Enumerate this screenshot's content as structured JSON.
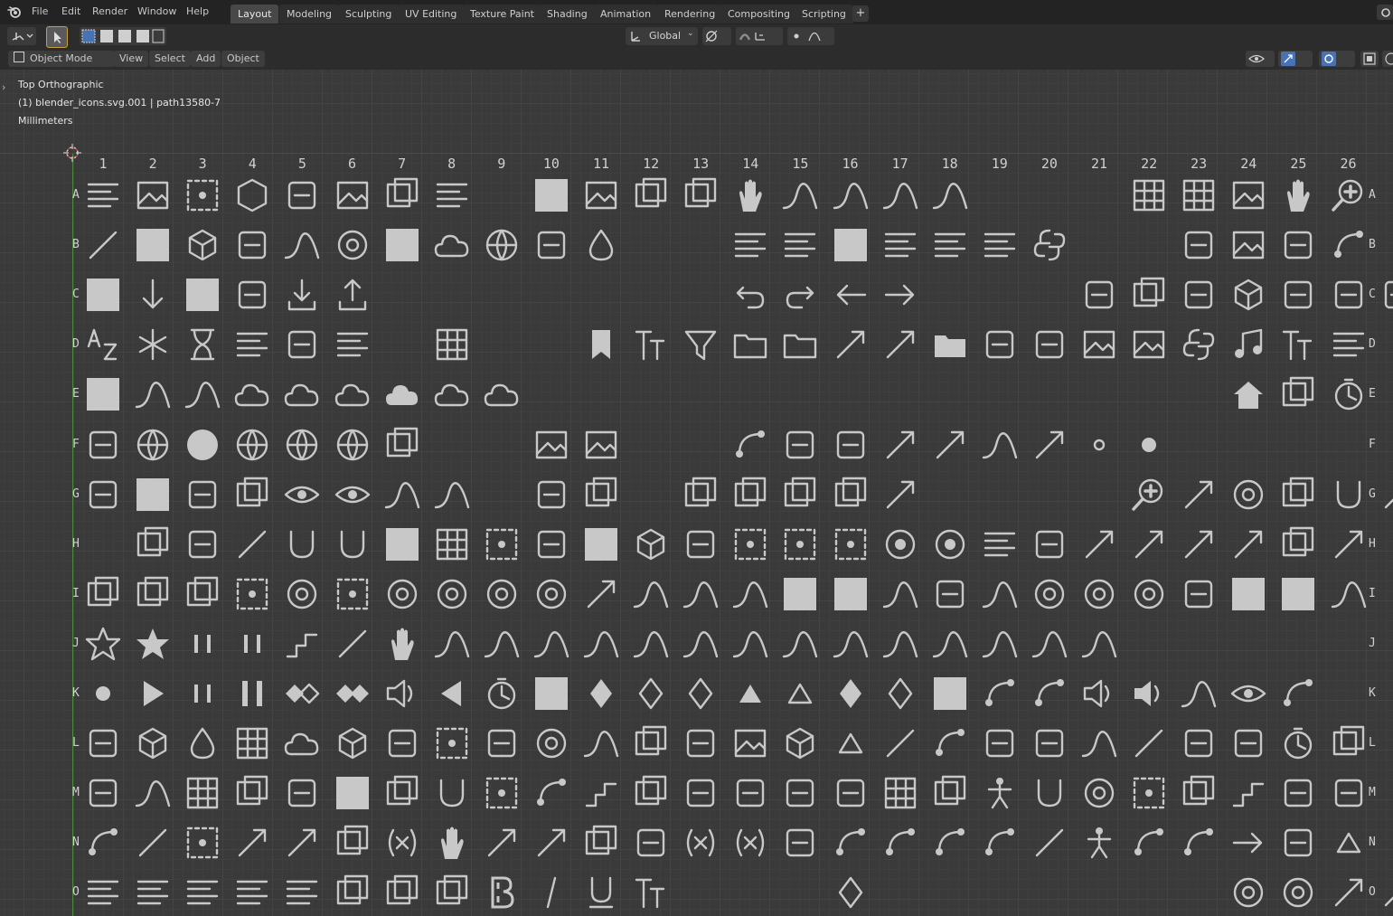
{
  "menubar": {
    "items": [
      "File",
      "Edit",
      "Render",
      "Window",
      "Help"
    ]
  },
  "workspace_tabs": [
    {
      "label": "Layout",
      "active": true
    },
    {
      "label": "Modeling"
    },
    {
      "label": "Sculpting"
    },
    {
      "label": "UV Editing"
    },
    {
      "label": "Texture Paint"
    },
    {
      "label": "Shading"
    },
    {
      "label": "Animation"
    },
    {
      "label": "Rendering"
    },
    {
      "label": "Compositing"
    },
    {
      "label": "Scripting"
    }
  ],
  "tab_add_label": "+",
  "toolbar": {
    "transform_orientation": "Global"
  },
  "header": {
    "mode": "Object Mode",
    "menus": [
      "View",
      "Select",
      "Add",
      "Object"
    ]
  },
  "viewport_overlay": {
    "view_name": "Top Orthographic",
    "object_info": "(1) blender_icons.svg.001 | path13580-7",
    "units": "Millimeters"
  },
  "grid": {
    "columns": [
      "1",
      "2",
      "3",
      "4",
      "5",
      "6",
      "7",
      "8",
      "9",
      "10",
      "11",
      "12",
      "13",
      "14",
      "15",
      "16",
      "17",
      "18",
      "19",
      "20",
      "21",
      "22",
      "23",
      "24",
      "25",
      "26"
    ],
    "rows": [
      "A",
      "B",
      "C",
      "D",
      "E",
      "F",
      "G",
      "H",
      "I",
      "J",
      "K",
      "L",
      "M",
      "N",
      "O"
    ],
    "right_rows": [
      "A",
      "B",
      "C",
      "D",
      "E",
      "F",
      "G",
      "H",
      "I",
      "J",
      "K",
      "L",
      "M",
      "N",
      "O"
    ]
  },
  "colors": {
    "background": "#393939",
    "topbar": "#232323",
    "icon": "#c8c8c8",
    "x_axis": "#8e2d2d",
    "y_axis": "#4b8a3a",
    "active_tab": "#484848"
  },
  "icon_sheet": [
    {
      "row": "A",
      "icons": [
        "align-icon",
        "image-icon",
        "dots-diagonal-icon",
        "hexagon-icon",
        "histogram-icon",
        "image-plane-icon",
        "select-box-icon",
        "align-bars-icon",
        "",
        "blank-square-icon",
        "image-alpha-icon",
        "half-square-icon",
        "overlap-squares-icon",
        "curve-handle-icon",
        "curve-arc-icon",
        "curve-point-icon",
        "curve-peak-icon",
        "curve-vertex-icon",
        "",
        "",
        "",
        "grid-perspective-icon",
        "grid-icon",
        "camera-film-icon",
        "hand-icon",
        "zoom-in-icon"
      ]
    },
    {
      "row": "B",
      "icons": [
        "square-outline-icon",
        "square-filled-icon",
        "cube-icon",
        "monkey-icon",
        "wave-icon",
        "circle-dots-icon",
        "square-filled-icon",
        "particles-icon",
        "sphere-head-icon",
        "shirt-icon",
        "drop-icon",
        "",
        "",
        "text-lines-icon",
        "text-box-icon",
        "square-filled-icon",
        "list-header-icon",
        "list-lines-icon",
        "numbered-list-icon",
        "python-icon",
        "",
        "",
        "disc-icon",
        "window-icon",
        "device-icon",
        "node-tree-icon"
      ]
    },
    {
      "row": "C",
      "icons": [
        "square-filled-icon",
        "arrow-down-icon",
        "square-filled-icon",
        "paperclip-icon",
        "import-icon",
        "export-icon",
        "",
        "",
        "",
        "",
        "",
        "",
        "",
        "undo-icon",
        "redo-icon",
        "arrow-left-icon",
        "arrow-right-icon",
        "",
        "",
        "",
        "pixel-icon",
        "settings-box-icon",
        "volume-icon",
        "cube-outline-icon",
        "file-fold-icon",
        "bake-icon",
        "sd-card-icon"
      ]
    },
    {
      "row": "D",
      "icons": [
        "sort-az-icon",
        "asterisk-icon",
        "hourglass-icon",
        "sort-lines-icon",
        "sequence-icon",
        "dotted-list-icon",
        "",
        "grid-four-icon",
        "",
        "",
        "bookmark-icon",
        "font-f-icon",
        "filter-icon",
        "new-folder-icon",
        "folder-link-icon",
        "parent-arrow-icon",
        "refresh-icon",
        "folder-icon",
        "half-flag-icon",
        "blender-icon",
        "image-file-icon",
        "film-icon",
        "python-logo-icon",
        "music-icon",
        "font-icon",
        "text-align-icon"
      ]
    },
    {
      "row": "E",
      "icons": [
        "square-filled-icon",
        "stroke-icon",
        "stroke-two-icon",
        "metaballs-icon",
        "metaball-outline-icon",
        "metaball-split-icon",
        "cloud-filled-icon",
        "cloud-outline-icon",
        "cloud-outline-icon",
        "",
        "",
        "",
        "",
        "",
        "",
        "",
        "",
        "",
        "",
        "",
        "",
        "",
        "",
        "home-icon",
        "stack-icon",
        "dashed-clock-icon"
      ]
    },
    {
      "row": "F",
      "icons": [
        "fullscreen-icon",
        "globe-icon",
        "sphere-filled-icon",
        "sphere-shaded-icon",
        "sphere-half-icon",
        "sphere-link-icon",
        "square-link-icon",
        "",
        "",
        "monitor-link-icon",
        "monitor-icon",
        "",
        "",
        "book-open-icon",
        "book-page-icon",
        "plane-icon",
        "lock-move-icon",
        "rotate-arrow-icon",
        "wave-tilde-icon",
        "vertical-arrows-icon",
        "small-dot-icon",
        "dot-icon"
      ]
    },
    {
      "row": "G",
      "icons": [
        "clipboard-paste-icon",
        "square-filled-icon",
        "cursor-select-icon",
        "scale-box-icon",
        "eye-cursor-icon",
        "eye-curve-icon",
        "cursor-curve-icon",
        "curve-bracket-icon",
        "",
        "link-dash-icon",
        "link-box-icon",
        "",
        "parent-boxes-icon",
        "box-split-icon",
        "box-cut-icon",
        "box-bar-icon",
        "resize-diag-icon",
        "",
        "",
        "",
        "",
        "zoom-box-icon",
        "arc-arrow-icon",
        "ring-cross-icon",
        "transform-box-icon",
        "hook-box-icon",
        "corner-arrow-icon"
      ]
    },
    {
      "row": "H",
      "icons": [
        "",
        "square-dot-icon",
        "axis-corner-icon",
        "line-dot-icon",
        "magnet-icon",
        "magnet-filled-icon",
        "square-filled-icon",
        "snap-grid-icon",
        "four-dots-icon",
        "bars-icon",
        "square-filled-icon",
        "cube-solid-icon",
        "ruler-icon",
        "dotted-box-icon",
        "scatter-icon",
        "diagonal-dots-icon",
        "record-icon",
        "record-ring-icon",
        "align-center-icon",
        "perspective-icon",
        "move-up-icon",
        "axis-arrows-icon",
        "cross-arrows-icon",
        "vertex-arrows-icon",
        "box-arrow-icon",
        "corner-arrows-icon"
      ]
    },
    {
      "row": "I",
      "icons": [
        "square-rounded-icon",
        "square-rotate-icon",
        "square-back-icon",
        "dashed-loop-icon",
        "x-circle-icon",
        "dashed-square-icon",
        "x-target-icon",
        "two-circles-icon",
        "link-circles-icon",
        "overlap-circles-icon",
        "double-arrow-icon",
        "hill-icon",
        "bell-curve-icon",
        "arch-icon",
        "square-filled-icon",
        "square-filled-icon",
        "peak-icon",
        "bracket-icon",
        "spike-icon",
        "target-icon",
        "ring-double-icon",
        "ring-icon",
        "spiral-icon",
        "square-filled-icon",
        "square-filled-icon",
        "arc-stroke-icon"
      ]
    },
    {
      "row": "J",
      "icons": [
        "star-outline-icon",
        "star-filled-icon",
        "tick-icon",
        "dashed-cut-icon",
        "step-icon",
        "line-icon",
        "curve-handle-icon",
        "curve-one-icon",
        "curve-two-icon",
        "curve-three-icon",
        "curve-four-icon",
        "curve-five-icon",
        "curve-s-icon",
        "curve-smooth-icon",
        "curve-noise-icon",
        "curve-wavy-icon",
        "curve-valley-icon",
        "curve-rise-icon",
        "curve-ease-icon",
        "curve-soft-icon",
        "curve-frame-icon"
      ]
    },
    {
      "row": "K",
      "icons": [
        "dot-filled-icon",
        "play-icon",
        "tick-icon",
        "pause-icon",
        "bow-tie-icon",
        "bow-tie-filled-icon",
        "speaker-wave-icon",
        "play-reverse-icon",
        "stopwatch-icon",
        "square-filled-icon",
        "keyframe-tall-icon",
        "keyframe-outline-icon",
        "keyframe-outline-icon",
        "triangle-filled-icon",
        "triangle-outline-icon",
        "diamond-filled-icon",
        "diamond-outline-icon",
        "square-filled-icon",
        "node-x-icon",
        "node-plus-icon",
        "speaker-icon",
        "speaker-loud-icon",
        "smile-curve-icon",
        "eye-icon",
        "nodes-transform-icon"
      ]
    },
    {
      "row": "L",
      "icons": [
        "armature-icon",
        "cube-split-icon",
        "drop-outline-icon",
        "grid-cells-icon",
        "blob-icon",
        "cube-open-icon",
        "donut-icon",
        "dotted-network-icon",
        "splash-icon",
        "half-circle-icon",
        "waves-icon",
        "bezier-box-icon",
        "corner-round-icon",
        "window-split-icon",
        "cube-dotted-icon",
        "target-triangle-icon",
        "spline-icon",
        "nodes-icon",
        "sliders-icon",
        "zigzag-icon",
        "curve-branch-icon",
        "node-line-icon",
        "thick-arc-icon",
        "signal-icon",
        "clock-icon",
        "copy-icon"
      ]
    },
    {
      "row": "M",
      "icons": [
        "wrench-icon",
        "wave-corner-icon",
        "bricks-icon",
        "half-square-icon",
        "butterfly-icon",
        "square-filled-icon",
        "round-square-icon",
        "hook-icon",
        "dashed-scale-icon",
        "corner-nodes-icon",
        "steps-icon",
        "frame-icon",
        "bars-chart-icon",
        "checker-icon",
        "trapezoid-icon",
        "half-moon-icon",
        "grid-skew-icon",
        "rotate-square-icon",
        "figure-icon",
        "horseshoe-icon",
        "circle-quarter-icon",
        "frame-dots-icon",
        "diag-square-icon",
        "stair-icon",
        "curl-icon",
        "yin-icon"
      ]
    },
    {
      "row": "N",
      "icons": [
        "node-socket-icon",
        "spline-gear-icon",
        "dashed-frame-icon",
        "rotate-arrows-icon",
        "spiral-arrow-icon",
        "overlap-boxes-icon",
        "paren-x-icon",
        "diagonal-handles-icon",
        "corner-arrow-l-icon",
        "rotate-back-icon",
        "square-half-icon",
        "bar-pair-icon",
        "paren-x-big-icon",
        "paren-fx-icon",
        "spray-icon",
        "node-chain-icon",
        "node-dot-icon",
        "bone-icon",
        "pen-icon",
        "dashed-line-dot-icon",
        "figure-pose-icon",
        "pin-node-icon",
        "node-dot-bottom-icon",
        "spiral-arrow-right-icon",
        "polygon-dot-icon",
        "triangle-cut-icon"
      ]
    },
    {
      "row": "O",
      "icons": [
        "align-left-icon",
        "align-center-text-icon",
        "align-right-icon",
        "align-justify-icon",
        "align-dotted-icon",
        "box-top-icon",
        "box-mid-icon",
        "box-bottom-icon",
        "bold-icon",
        "italic-icon",
        "underline-icon",
        "small-caps-icon",
        "",
        "",
        "",
        "keyframe-dots-icon",
        "",
        "",
        "",
        "",
        "",
        "",
        "",
        "circle-outline-icon",
        "circle-square-icon",
        "check-arrow-icon",
        "arrow-up-right-icon"
      ]
    }
  ]
}
